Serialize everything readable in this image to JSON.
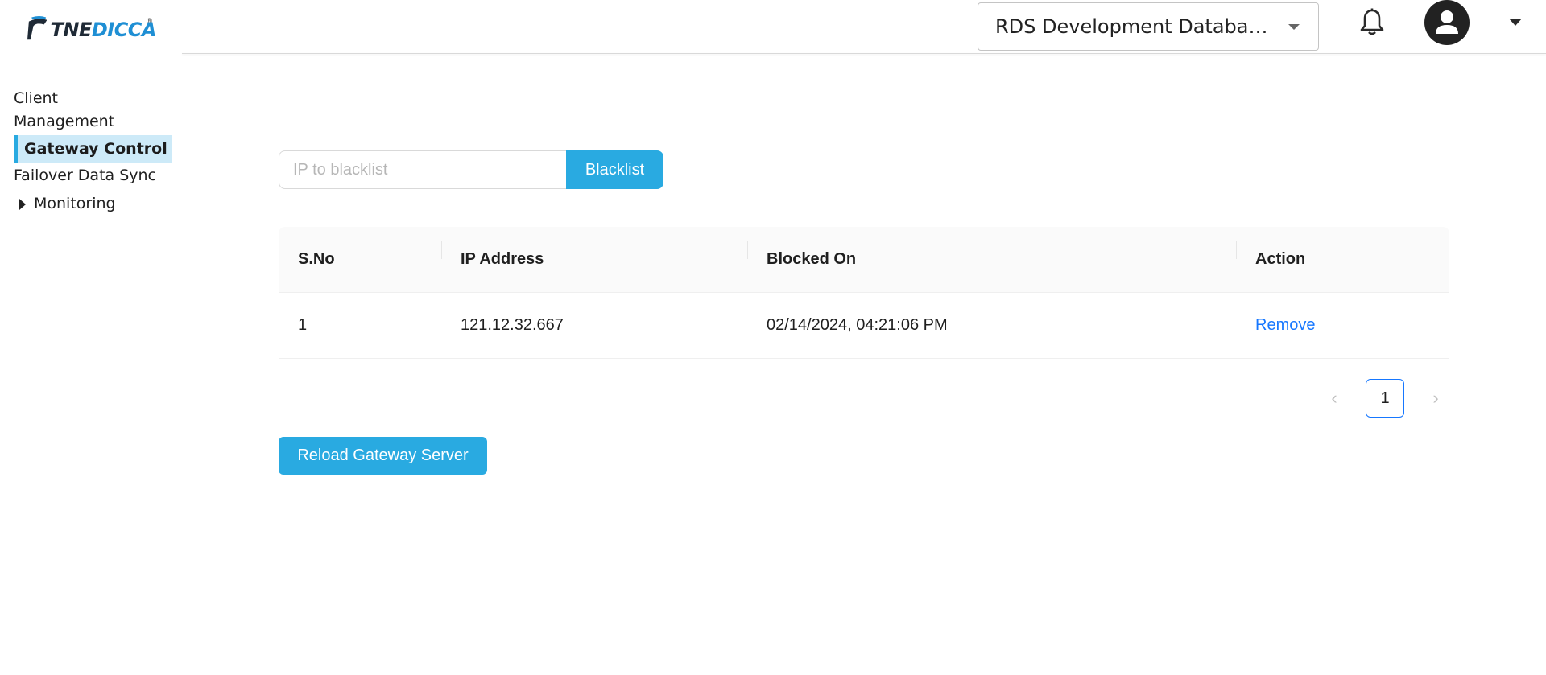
{
  "header": {
    "logo_text_dark": "TNE",
    "logo_text_blue": "DICCA",
    "logo_reg": "®",
    "database_selector": "RDS Development Database EL...",
    "icons": {
      "notifications": "bell-icon",
      "avatar": "user-avatar-icon",
      "menu": "caret-down-icon"
    }
  },
  "sidebar": {
    "items": [
      {
        "label": "Client Management"
      },
      {
        "label": "Gateway Control",
        "active": true
      },
      {
        "label": "Failover Data Sync"
      },
      {
        "label": "Monitoring",
        "expandable": true
      }
    ]
  },
  "blacklist_form": {
    "placeholder": "IP to blacklist",
    "value": "",
    "button_label": "Blacklist"
  },
  "table": {
    "columns": [
      "S.No",
      "IP Address",
      "Blocked On",
      "Action"
    ],
    "rows": [
      {
        "sno": "1",
        "ip": "121.12.32.667",
        "blocked_on": "02/14/2024, 04:21:06 PM",
        "action": "Remove"
      }
    ]
  },
  "pagination": {
    "prev": "‹",
    "current": "1",
    "next": "›"
  },
  "reload_button": "Reload Gateway Server",
  "colors": {
    "accent": "#29aae1",
    "link": "#1677ff",
    "active_nav_bg": "#cdeaf8"
  }
}
